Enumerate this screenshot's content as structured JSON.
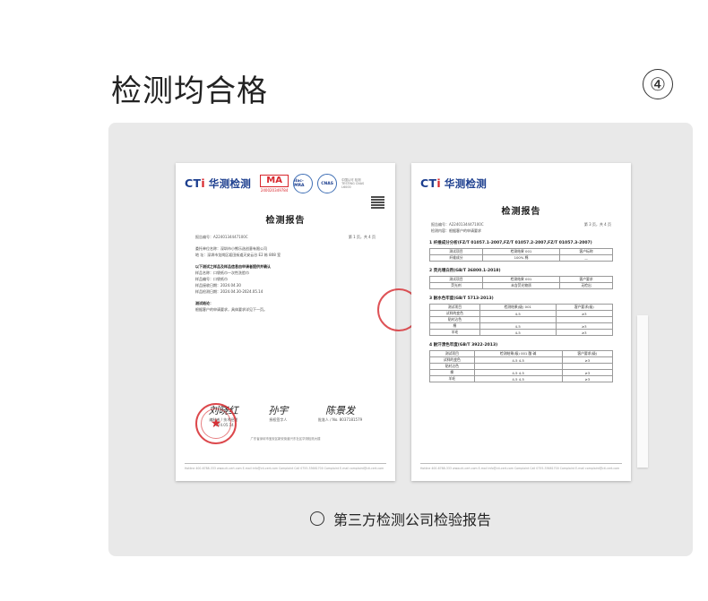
{
  "heading": "检测均合格",
  "step_number": "④",
  "caption": "第三方检测公司检验报告",
  "report_left": {
    "brand_en_a": "CT",
    "brand_en_b": "i",
    "brand_cn": "华测检测",
    "cma_label": "MA",
    "cma_number": "240020349784",
    "ilac_label": "ilac-MRA",
    "cnas_label": "CNAS",
    "cnas_fine": "中国认可 检测 TESTING CNAS L6000",
    "title": "检测报告",
    "report_no": "报告编号：A2240134447100C",
    "page_no": "第 1 页，共 4 页",
    "applicant": "委托单位名称：深圳市小熊乐选创意有限公司",
    "address": "地 址：深圳市龙岗区坂田街道天安云谷 E2 栋 808 室",
    "section_heading": "以下测试之样品及样品信息由申请者提供并确认",
    "sample_name": "样品名称：口袋纸巾一次性洗脸巾",
    "sample_id": "样品编号：口袋纸巾",
    "receive_date": "样品接收日期：2024.04.30",
    "test_period": "样品检测日期：2024.04.30-2024.05.14",
    "test_method_title": "测试结论：",
    "test_method": "根据客户的申请要求，具体要求详见下一页。",
    "sig_1_hand": "刘晓红",
    "sig_1_role": "编制者 / 技术经理",
    "sig_2_hand": "孙宇",
    "sig_2_role": "授权签字人",
    "sig_3_hand": "陈景发",
    "sig_3_role": "批准人 / No. 8037181579",
    "date": "2024.05.14",
    "footnote": "广东省深圳市宝安区新安街道兴东社区华测检测大楼",
    "footer": "Hotline 400-6788-333    www.cti-cert.com    E-mail info@cti-cert.com    Complaint Call 0755-33681700    Complaint E-mail complaint@cti-cert.com"
  },
  "report_right": {
    "brand_en_a": "CT",
    "brand_en_b": "i",
    "brand_cn": "华测检测",
    "title": "检测报告",
    "report_no": "报告编号：A2240134447100C",
    "page_no": "第 3 页，共 4 页",
    "test_items": "检测内容：根据客户的申请要求",
    "sec1": "1  纤维成分分析(FZ/T 01057.1-2007,FZ/T 01057.2-2007,FZ/T 01057.3-2007)",
    "sec1_rows": [
      [
        "测试项目",
        "检测结果 001",
        "客户标称"
      ],
      [
        "纤维成分",
        "100% 棉",
        "—"
      ]
    ],
    "sec2": "2  荧光增白剂(GB/T 36800.1-2018)",
    "sec2_rows": [
      [
        "测试项目",
        "检测结果 001",
        "客户要求"
      ],
      [
        "荧光剂",
        "未含荧光物质",
        "无检出"
      ]
    ],
    "sec3": "3  耐水色牢度(GB/T 5713-2013)",
    "sec3_rows": [
      [
        "测试项目",
        "检测结果(级) 001",
        "客户要求(级)"
      ],
      [
        "试样的变色",
        "4-5",
        "≥3"
      ],
      [
        "贴衬沾色",
        "",
        ""
      ],
      [
        "棉",
        "4-5",
        "≥3"
      ],
      [
        "羊毛",
        "4-5",
        "≥3"
      ]
    ],
    "sec4": "4  耐汗渍色牢度(GB/T 3922-2013)",
    "sec4_rows": [
      [
        "测试项目",
        "检测结果(级) 001 酸 碱",
        "客户要求(级)"
      ],
      [
        "试样的变色",
        "4-5  4-5",
        "≥3"
      ],
      [
        "贴衬沾色",
        "",
        ""
      ],
      [
        "棉",
        "4-5  4-5",
        "≥3"
      ],
      [
        "羊毛",
        "4-5  4-5",
        "≥3"
      ]
    ],
    "footer": "Hotline 400-6788-333    www.cti-cert.com    E-mail info@cti-cert.com    Complaint Call 0755-33681700    Complaint E-mail complaint@cti-cert.com"
  }
}
